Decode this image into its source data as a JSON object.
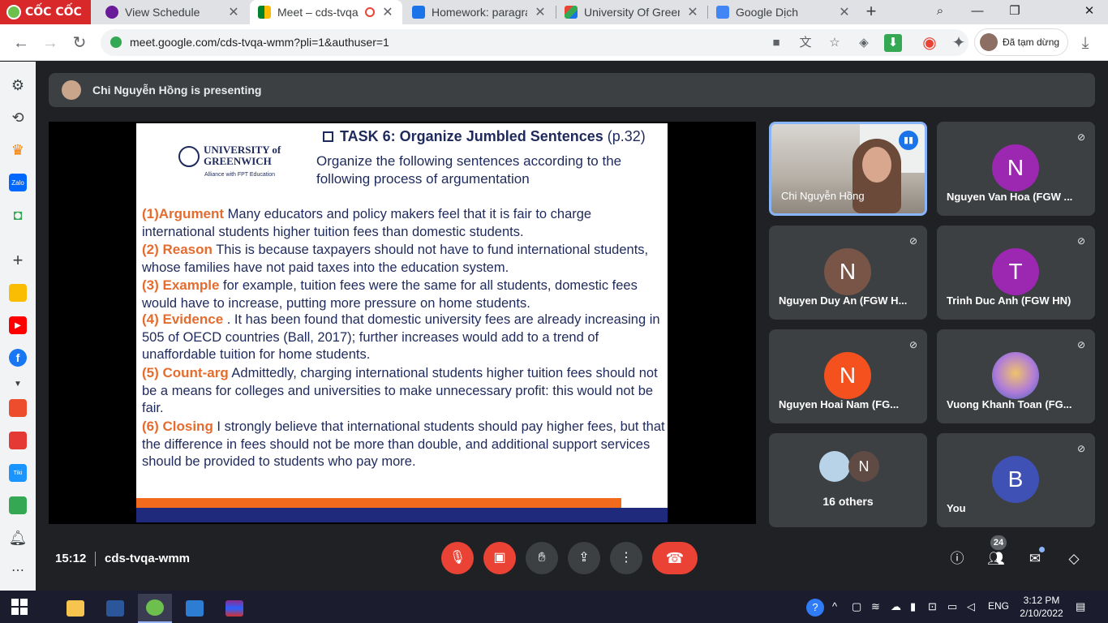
{
  "browser": {
    "brand": "CỐC CỐC",
    "tabs": [
      {
        "title": "View Schedule",
        "close": "✕"
      },
      {
        "title": "Meet – cds-tvqa-",
        "close": "✕"
      },
      {
        "title": "Homework: paragrap",
        "close": "✕"
      },
      {
        "title": "University Of Greenw",
        "close": "✕"
      },
      {
        "title": "Google Dịch",
        "close": "✕"
      }
    ],
    "new_tab": "+",
    "url": "meet.google.com/cds-tvqa-wmm?pli=1&authuser=1",
    "profile_label": "Đã tạm dừng"
  },
  "meet": {
    "presenting_text": "Chi Nguyễn Hồng is presenting",
    "slide": {
      "university": "UNIVERSITY of GREENWICH",
      "alliance": "Alliance with FPT Education",
      "task_title": "TASK 6: Organize Jumbled Sentences",
      "task_page": "(p.32)",
      "instruction": "Organize the following sentences according to the following process of argumentation",
      "steps": [
        {
          "label": "(1)Argument",
          "text": " Many educators and policy makers feel that it is fair to charge international students higher tuition fees than domestic students."
        },
        {
          "label": "(2) Reason",
          "text": " This is because taxpayers should not have to fund international students, whose families have not paid taxes into the education system."
        },
        {
          "label": "(3) Example",
          "text": "  for example, tuition fees were the same for all students, domestic fees would have to increase, putting more pressure on home students."
        },
        {
          "label": "(4) Evidence",
          "text": " . It has been found that domestic university fees are already increasing in 505 of OECD countries (Ball, 2017); further increases would add to a trend of unaffordable tuition for home students."
        },
        {
          "label": "(5) Count-arg",
          "text": " Admittedly, charging international students higher tuition fees should not be a means for colleges and universities to make unnecessary profit: this would not be fair."
        },
        {
          "label": "(6) Closing",
          "text": " I strongly believe that international students should pay higher fees, but that the difference in fees should not be more than double, and additional support services should be provided to students who pay more."
        }
      ]
    },
    "participants": [
      {
        "name": "Chi Nguyễn Hồng",
        "initial": "",
        "color": "",
        "speaking": true
      },
      {
        "name": "Nguyen Van Hoa (FGW ...",
        "initial": "N",
        "color": "#9c27b0"
      },
      {
        "name": "Nguyen Duy An (FGW H...",
        "initial": "N",
        "color": "#795548"
      },
      {
        "name": "Trinh Duc Anh (FGW HN)",
        "initial": "T",
        "color": "#9c27b0"
      },
      {
        "name": "Nguyen Hoai Nam (FG...",
        "initial": "N",
        "color": "#f4511e"
      },
      {
        "name": "Vuong Khanh Toan (FG...",
        "initial": "",
        "color": ""
      },
      {
        "name": "16 others",
        "initial": "N",
        "color": "#5f4b44"
      },
      {
        "name": "You",
        "initial": "B",
        "color": "#3f51b5"
      }
    ],
    "clock": "15:12",
    "meeting_code": "cds-tvqa-wmm",
    "participant_count": "24"
  },
  "taskbar": {
    "lang": "ENG",
    "time": "3:12 PM",
    "date": "2/10/2022"
  }
}
